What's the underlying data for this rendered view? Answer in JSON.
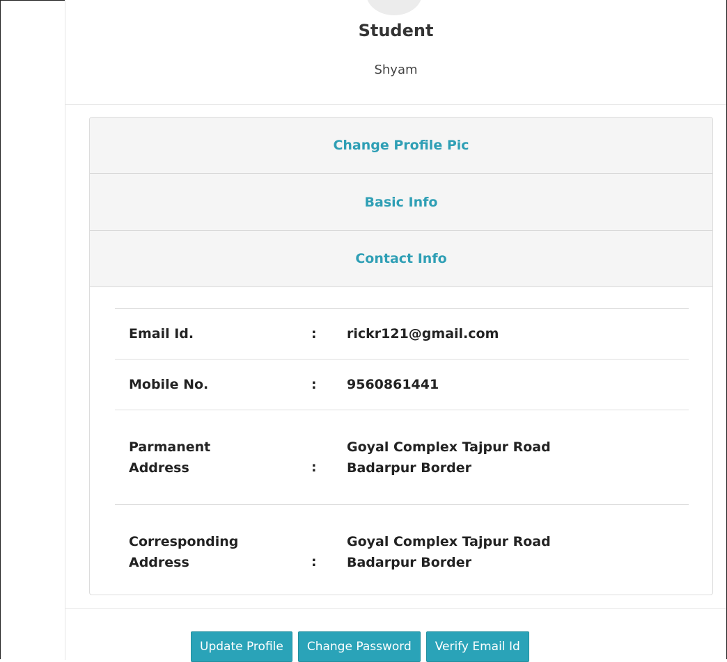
{
  "profile": {
    "role": "Student",
    "name": "Shyam"
  },
  "accordion": {
    "sections": [
      {
        "title": "Change Profile Pic"
      },
      {
        "title": "Basic Info"
      },
      {
        "title": "Contact Info"
      }
    ]
  },
  "contact": {
    "rows": [
      {
        "label": "Email Id.",
        "colon": ":",
        "value": "rickr121@gmail.com"
      },
      {
        "label": "Mobile No.",
        "colon": ":",
        "value": "9560861441"
      },
      {
        "label_line1": "Parmanent",
        "label_line2": "Address",
        "colon": ":",
        "value_line1": "Goyal Complex Tajpur Road",
        "value_line2": "Badarpur Border"
      },
      {
        "label_line1": "Corresponding",
        "label_line2": "Address",
        "colon": ":",
        "value_line1": "Goyal Complex Tajpur Road",
        "value_line2": "Badarpur Border"
      }
    ]
  },
  "actions": {
    "update_profile": "Update Profile",
    "change_password": "Change Password",
    "verify_email": "Verify Email Id"
  },
  "colors": {
    "accent": "#2aa3b8",
    "heading_link": "#2f9fb5",
    "accordion_bg": "#f5f5f5"
  }
}
